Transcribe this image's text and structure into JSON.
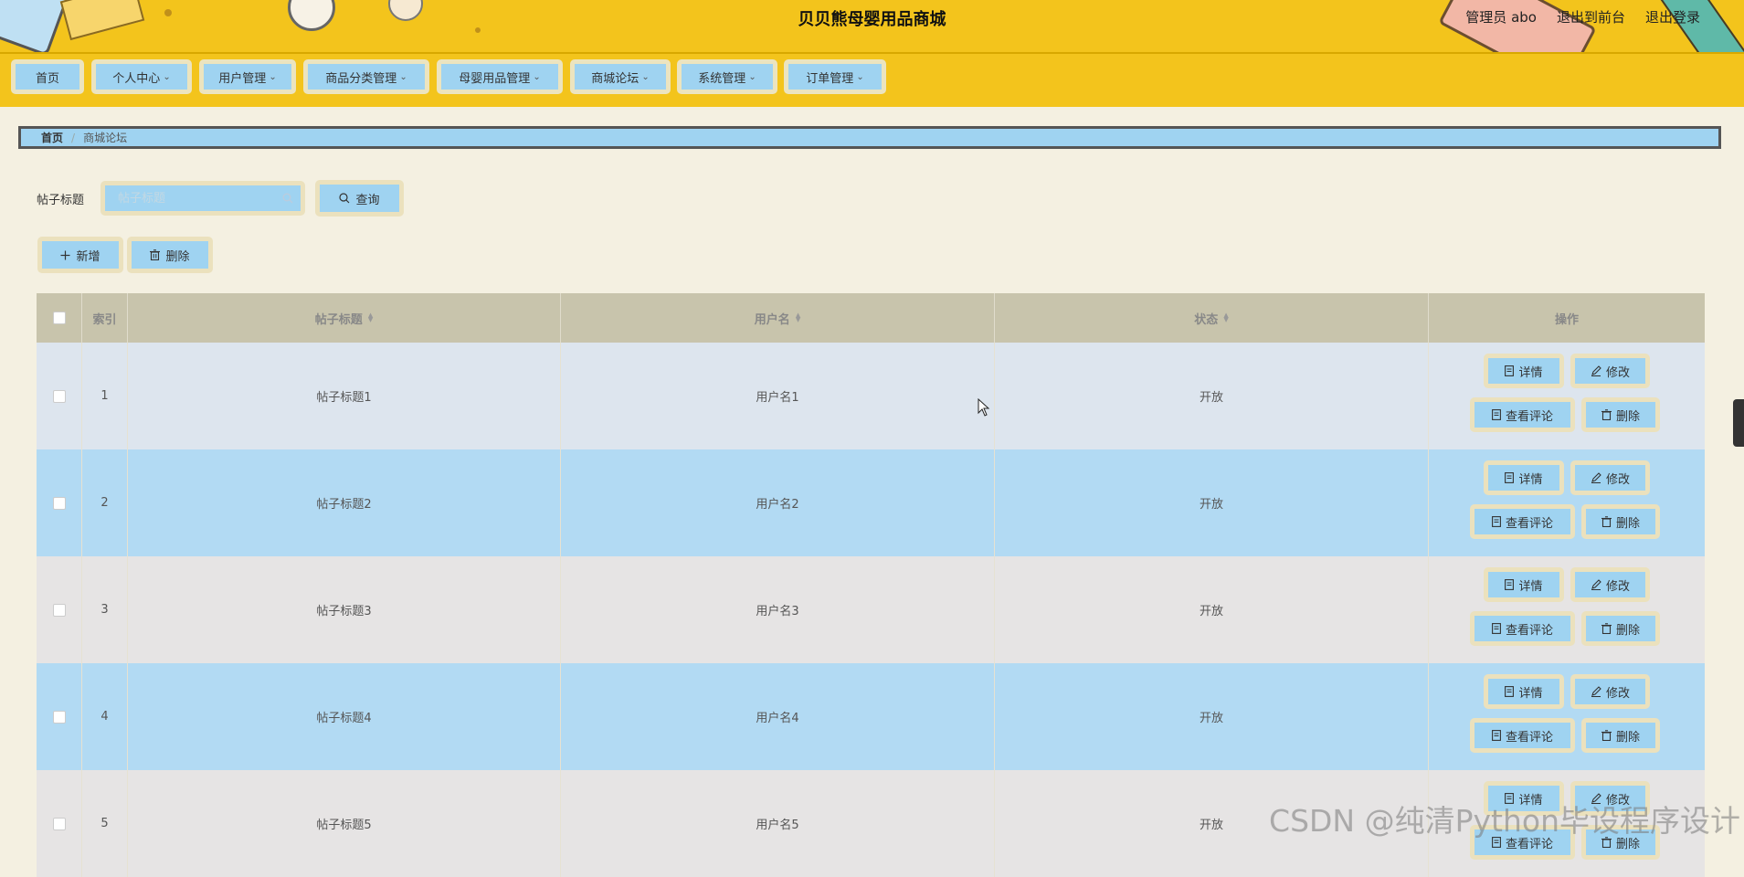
{
  "header": {
    "site_title": "贝贝熊母婴用品商城",
    "user_label": "管理员 abo",
    "front_link": "退出到前台",
    "logout_link": "退出登录"
  },
  "nav": {
    "items": [
      {
        "label": "首页",
        "has_dropdown": false
      },
      {
        "label": "个人中心",
        "has_dropdown": true
      },
      {
        "label": "用户管理",
        "has_dropdown": true
      },
      {
        "label": "商品分类管理",
        "has_dropdown": true
      },
      {
        "label": "母婴用品管理",
        "has_dropdown": true
      },
      {
        "label": "商城论坛",
        "has_dropdown": true
      },
      {
        "label": "系统管理",
        "has_dropdown": true
      },
      {
        "label": "订单管理",
        "has_dropdown": true
      }
    ]
  },
  "breadcrumb": {
    "home": "首页",
    "separator": "/",
    "current": "商城论坛"
  },
  "search": {
    "label": "帖子标题",
    "placeholder": "帖子标题",
    "value": "",
    "query_button": "查询"
  },
  "actions": {
    "add_button": "新增",
    "delete_button": "删除"
  },
  "table": {
    "columns": {
      "index": "索引",
      "title": "帖子标题",
      "username": "用户名",
      "status": "状态",
      "operation": "操作"
    },
    "row_buttons": {
      "detail": "详情",
      "edit": "修改",
      "view_comments": "查看评论",
      "delete": "删除"
    },
    "rows": [
      {
        "index": "1",
        "title": "帖子标题1",
        "username": "用户名1",
        "status": "开放"
      },
      {
        "index": "2",
        "title": "帖子标题2",
        "username": "用户名2",
        "status": "开放"
      },
      {
        "index": "3",
        "title": "帖子标题3",
        "username": "用户名3",
        "status": "开放"
      },
      {
        "index": "4",
        "title": "帖子标题4",
        "username": "用户名4",
        "status": "开放"
      },
      {
        "index": "5",
        "title": "帖子标题5",
        "username": "用户名5",
        "status": "开放"
      }
    ]
  },
  "watermark": "CSDN @纯清Python毕设程序设计",
  "colors": {
    "header_bg": "#f3c41c",
    "button_bg": "#9fd3f1",
    "button_border": "#ebe1bd",
    "page_bg": "#f4f0e1",
    "table_header_bg": "#c8c4ac",
    "row_light": "#dde5ee",
    "row_blue": "#b2daf3",
    "row_grey": "#e6e4e4"
  }
}
